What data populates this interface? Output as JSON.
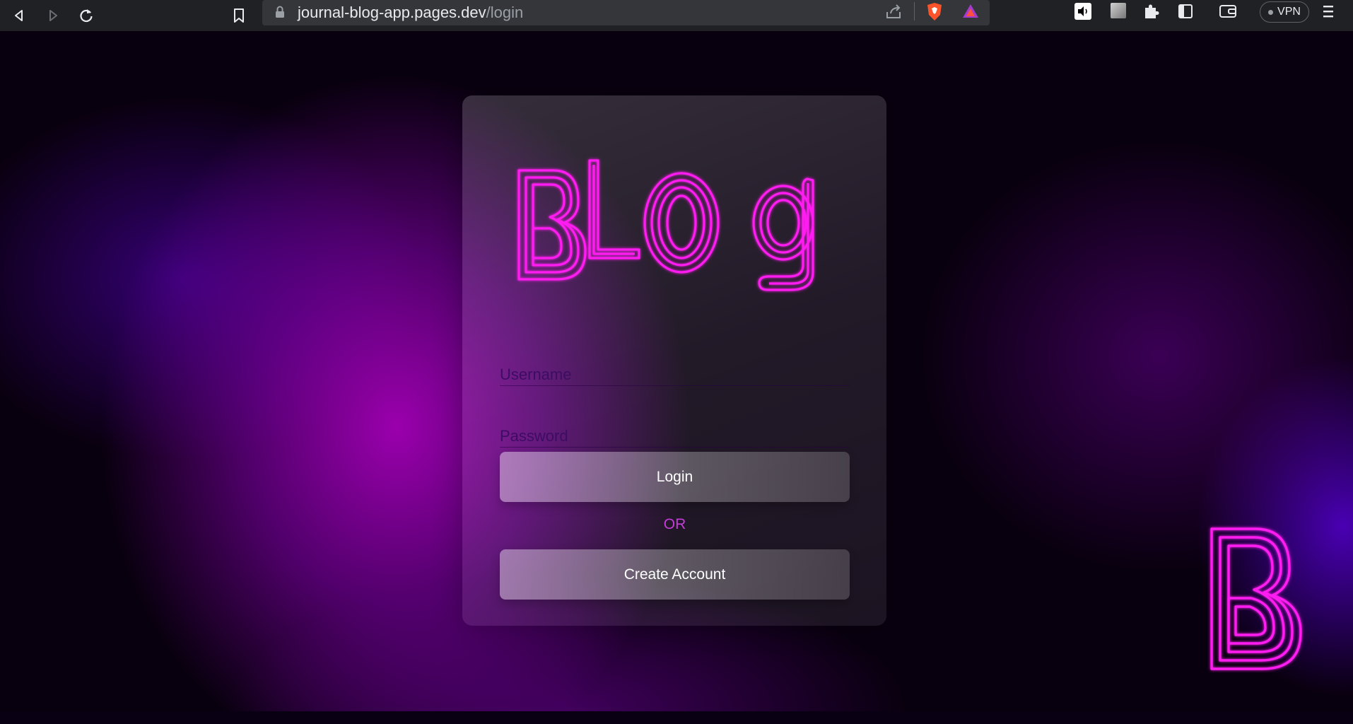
{
  "browser": {
    "url_host": "journal-blog-app.pages.dev",
    "url_path": "/login",
    "vpn_label": "VPN",
    "icons": [
      "back-icon",
      "forward-icon",
      "reload-icon",
      "bookmark-icon",
      "lock-icon",
      "share-icon",
      "brave-shield-icon",
      "brave-rewards-icon",
      "sound-icon",
      "extension-tile-icon",
      "puzzle-icon",
      "sidebar-icon",
      "wallet-icon",
      "menu-icon"
    ]
  },
  "logo": {
    "text": "BLOg",
    "color": "#ff1ff0"
  },
  "form": {
    "username_placeholder": "Username",
    "password_placeholder": "Password",
    "login_label": "Login",
    "or_label": "OR",
    "create_account_label": "Create Account"
  },
  "corner_logo": {
    "text": "B"
  },
  "colors": {
    "accent": "#ff1ff0",
    "or_text": "#c33cd6",
    "placeholder": "#3d0c63"
  }
}
